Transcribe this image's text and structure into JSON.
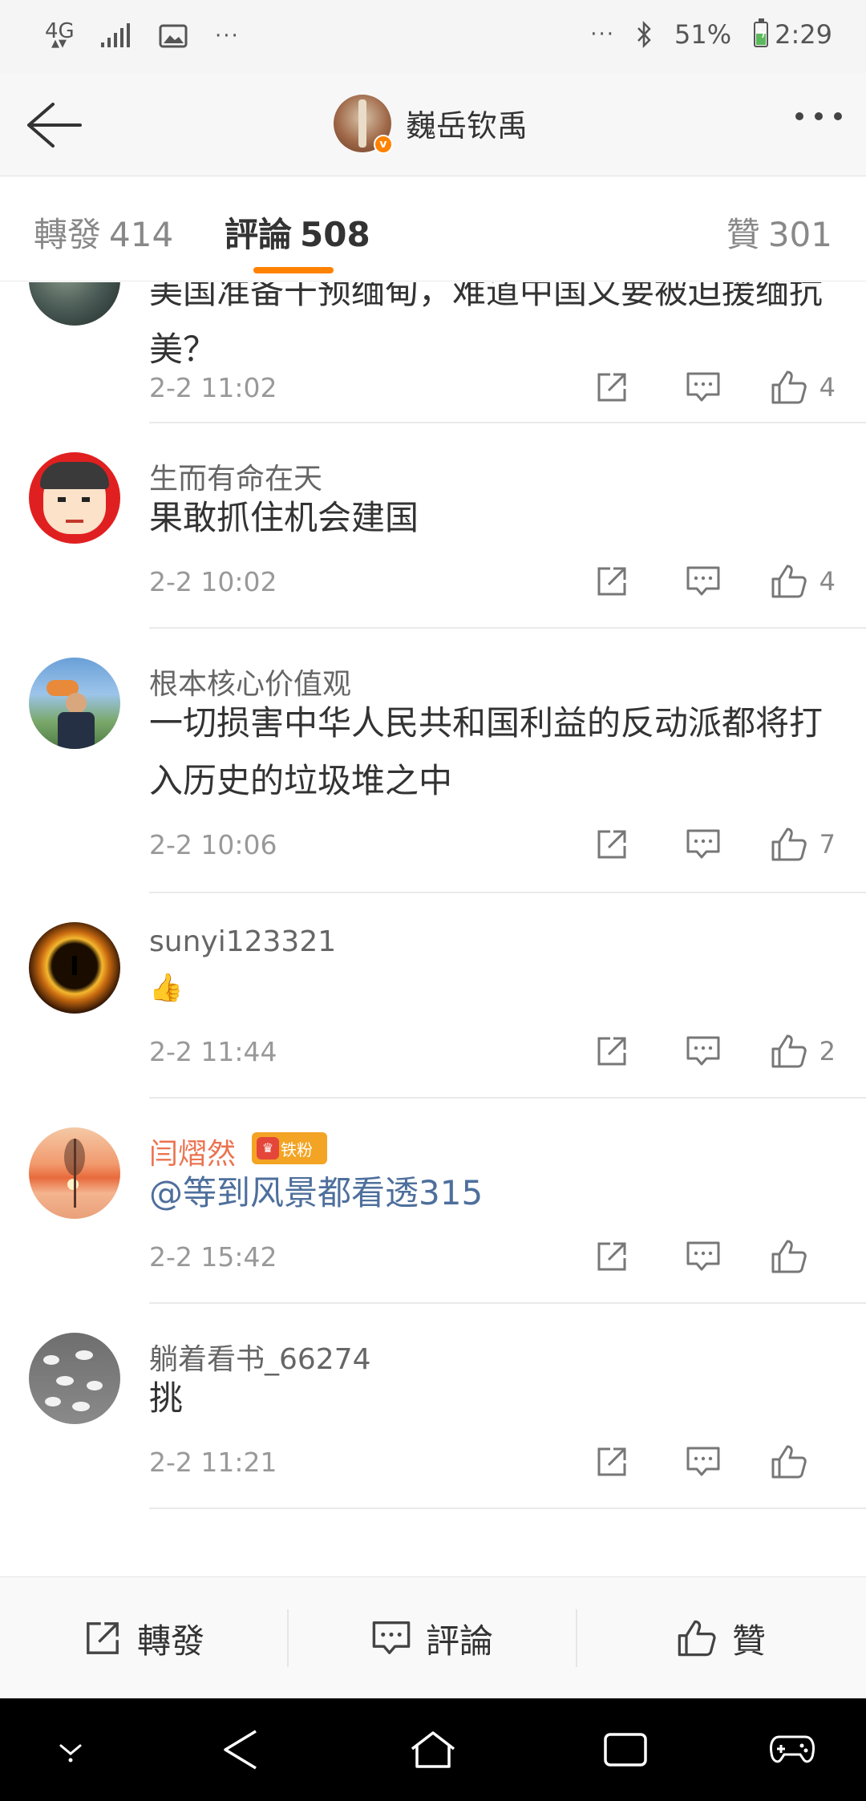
{
  "status_bar": {
    "network": "4G",
    "battery_percent": "51%",
    "time": "2:29",
    "left_more": "···",
    "right_more": "···",
    "battery_level": 0.51,
    "icons": [
      "signal-icon",
      "image-icon",
      "bluetooth-icon",
      "battery-icon"
    ]
  },
  "header": {
    "back_icon": "arrow-left-icon",
    "username": "巍岳钦禹",
    "verified_icon": "verified-badge-icon",
    "more_icon": "more-dots-icon"
  },
  "tabs": {
    "repost_label": "轉發",
    "repost_count": "414",
    "comment_label": "評論",
    "comment_count": "508",
    "like_label": "贊",
    "like_count": "301",
    "active": "comment"
  },
  "comments": [
    {
      "name": "",
      "text": "美国准备干预缅甸，难道中国又要被迫援缅抗美？",
      "time": "2-2 11:02",
      "likes": "4"
    },
    {
      "name": "生而有命在天",
      "text": "果敢抓住机会建国",
      "time": "2-2 10:02",
      "likes": "4"
    },
    {
      "name": "根本核心价值观",
      "text": "一切损害中华人民共和国利益的反动派都将打入历史的垃圾堆之中",
      "time": "2-2 10:06",
      "likes": "7"
    },
    {
      "name": "sunyi123321",
      "text": "👍",
      "time": "2-2 11:44",
      "likes": "2"
    },
    {
      "name": "闫熠然",
      "badge": "铁粉",
      "text": "@等到风景都看透315",
      "time": "2-2 15:42",
      "likes": ""
    },
    {
      "name": "躺着看书_66274",
      "text": "挑",
      "time": "2-2 11:21",
      "likes": ""
    }
  ],
  "bottom_bar": {
    "repost": "轉發",
    "comment": "評論",
    "like": "贊"
  },
  "colors": {
    "accent": "#ff8200",
    "link": "#4e6f9c",
    "fan_name": "#eb7350",
    "fan_badge": "#f3a424"
  }
}
